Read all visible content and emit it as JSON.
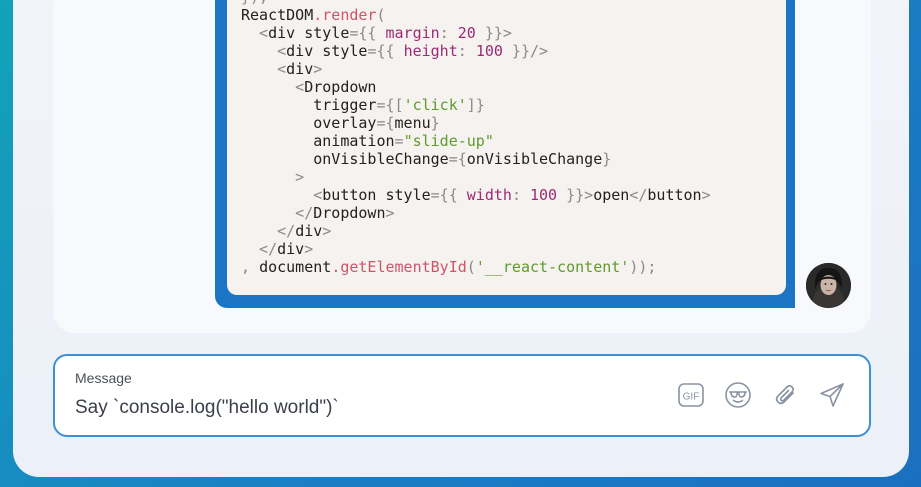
{
  "code": {
    "lines": [
      [
        {
          "t": "});",
          "c": "t-punct"
        }
      ],
      [
        {
          "t": "ReactDOM",
          "c": "t-var"
        },
        {
          "t": ".render",
          "c": "t-fn"
        },
        {
          "t": "(",
          "c": "t-punct"
        }
      ],
      [
        {
          "t": "  <",
          "c": "t-punct"
        },
        {
          "t": "div style",
          "c": "t-var"
        },
        {
          "t": "={{ ",
          "c": "t-punct"
        },
        {
          "t": "margin",
          "c": "t-attr"
        },
        {
          "t": ": ",
          "c": "t-punct"
        },
        {
          "t": "20",
          "c": "t-num"
        },
        {
          "t": " }}>",
          "c": "t-punct"
        }
      ],
      [
        {
          "t": "    <",
          "c": "t-punct"
        },
        {
          "t": "div style",
          "c": "t-var"
        },
        {
          "t": "={{ ",
          "c": "t-punct"
        },
        {
          "t": "height",
          "c": "t-attr"
        },
        {
          "t": ": ",
          "c": "t-punct"
        },
        {
          "t": "100",
          "c": "t-num"
        },
        {
          "t": " }}/>",
          "c": "t-punct"
        }
      ],
      [
        {
          "t": "    <",
          "c": "t-punct"
        },
        {
          "t": "div",
          "c": "t-var"
        },
        {
          "t": ">",
          "c": "t-punct"
        }
      ],
      [
        {
          "t": "      <",
          "c": "t-punct"
        },
        {
          "t": "Dropdown",
          "c": "t-var"
        }
      ],
      [
        {
          "t": "        trigger",
          "c": "t-var"
        },
        {
          "t": "={[",
          "c": "t-punct"
        },
        {
          "t": "'click'",
          "c": "t-str"
        },
        {
          "t": "]}",
          "c": "t-punct"
        }
      ],
      [
        {
          "t": "        overlay",
          "c": "t-var"
        },
        {
          "t": "={",
          "c": "t-punct"
        },
        {
          "t": "menu",
          "c": "t-var"
        },
        {
          "t": "}",
          "c": "t-punct"
        }
      ],
      [
        {
          "t": "        animation",
          "c": "t-var"
        },
        {
          "t": "=",
          "c": "t-punct"
        },
        {
          "t": "\"slide-up\"",
          "c": "t-str"
        }
      ],
      [
        {
          "t": "        onVisibleChange",
          "c": "t-var"
        },
        {
          "t": "={",
          "c": "t-punct"
        },
        {
          "t": "onVisibleChange",
          "c": "t-var"
        },
        {
          "t": "}",
          "c": "t-punct"
        }
      ],
      [
        {
          "t": "      >",
          "c": "t-punct"
        }
      ],
      [
        {
          "t": "        <",
          "c": "t-punct"
        },
        {
          "t": "button style",
          "c": "t-var"
        },
        {
          "t": "={{ ",
          "c": "t-punct"
        },
        {
          "t": "width",
          "c": "t-attr"
        },
        {
          "t": ": ",
          "c": "t-punct"
        },
        {
          "t": "100",
          "c": "t-num"
        },
        {
          "t": " }}>",
          "c": "t-punct"
        },
        {
          "t": "open",
          "c": "t-var"
        },
        {
          "t": "</",
          "c": "t-punct"
        },
        {
          "t": "button",
          "c": "t-var"
        },
        {
          "t": ">",
          "c": "t-punct"
        }
      ],
      [
        {
          "t": "      </",
          "c": "t-punct"
        },
        {
          "t": "Dropdown",
          "c": "t-var"
        },
        {
          "t": ">",
          "c": "t-punct"
        }
      ],
      [
        {
          "t": "    </",
          "c": "t-punct"
        },
        {
          "t": "div",
          "c": "t-var"
        },
        {
          "t": ">",
          "c": "t-punct"
        }
      ],
      [
        {
          "t": "  </",
          "c": "t-punct"
        },
        {
          "t": "div",
          "c": "t-var"
        },
        {
          "t": ">",
          "c": "t-punct"
        }
      ],
      [
        {
          "t": ", ",
          "c": "t-punct"
        },
        {
          "t": "document",
          "c": "t-var"
        },
        {
          "t": ".getElementById",
          "c": "t-fn"
        },
        {
          "t": "(",
          "c": "t-punct"
        },
        {
          "t": "'__react-content'",
          "c": "t-str"
        },
        {
          "t": "));",
          "c": "t-punct"
        }
      ]
    ]
  },
  "composer": {
    "label": "Message",
    "placeholder": "Say `console.log(\"hello world\")`",
    "value": ""
  },
  "toolbar": {
    "gif_label": "GIF",
    "icons": [
      "gif-icon",
      "emoji-sunglasses-icon",
      "paperclip-icon",
      "send-icon"
    ]
  },
  "colors": {
    "accent": "#1c74c4",
    "border": "#3d8fd6",
    "code_bg": "#f5f2ef"
  }
}
